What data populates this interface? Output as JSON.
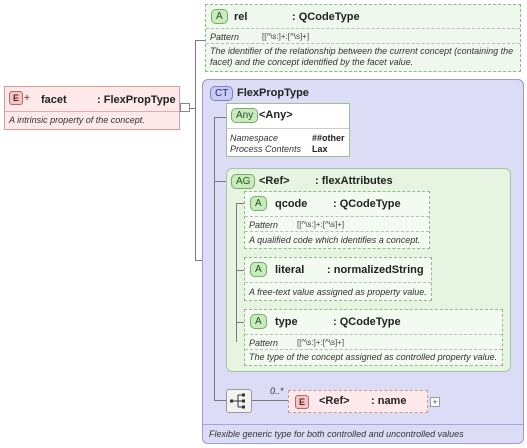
{
  "facet": {
    "badge": "E",
    "name": "facet",
    "type": ": FlexPropType",
    "doc": "A intrinsic property of the concept."
  },
  "rel": {
    "badge": "A",
    "name": "rel",
    "type": ": QCodeType",
    "pattern_label": "Pattern",
    "pattern": "[[^\\s:]+:[^\\s]+]",
    "doc": "The identifier of the relationship between the current concept (containing the facet) and the concept identified by the facet value."
  },
  "ct": {
    "badge": "CT",
    "name": "FlexPropType",
    "doc": "Flexible generic type for both controlled and uncontrolled values"
  },
  "any": {
    "badge": "Any",
    "name": "<Any>",
    "ns_label": "Namespace",
    "ns_value": "##other",
    "pc_label": "Process Contents",
    "pc_value": "Lax"
  },
  "ag": {
    "badge": "AG",
    "ref": "<Ref>",
    "type": ": flexAttributes"
  },
  "qcode": {
    "badge": "A",
    "name": "qcode",
    "type": ": QCodeType",
    "pattern_label": "Pattern",
    "pattern": "[[^\\s:]+:[^\\s]+]",
    "doc": "A qualified code which identifies a concept."
  },
  "literal": {
    "badge": "A",
    "name": "literal",
    "type": ": normalizedString",
    "doc": "A free-text value assigned as property value."
  },
  "typeattr": {
    "badge": "A",
    "name": "type",
    "type": ": QCodeType",
    "pattern_label": "Pattern",
    "pattern": "[[^\\s:]+:[^\\s]+]",
    "doc": "The type of the concept assigned as controlled property value."
  },
  "seq": {
    "cardinality": "0..*"
  },
  "nameref": {
    "badge": "E",
    "ref": "<Ref>",
    "type": ": name",
    "plus": "+"
  },
  "colors": {
    "element_fill": "#fde9e9",
    "attribute_fill": "#eff8ec",
    "complex_type_fill": "#dcdcf7"
  }
}
